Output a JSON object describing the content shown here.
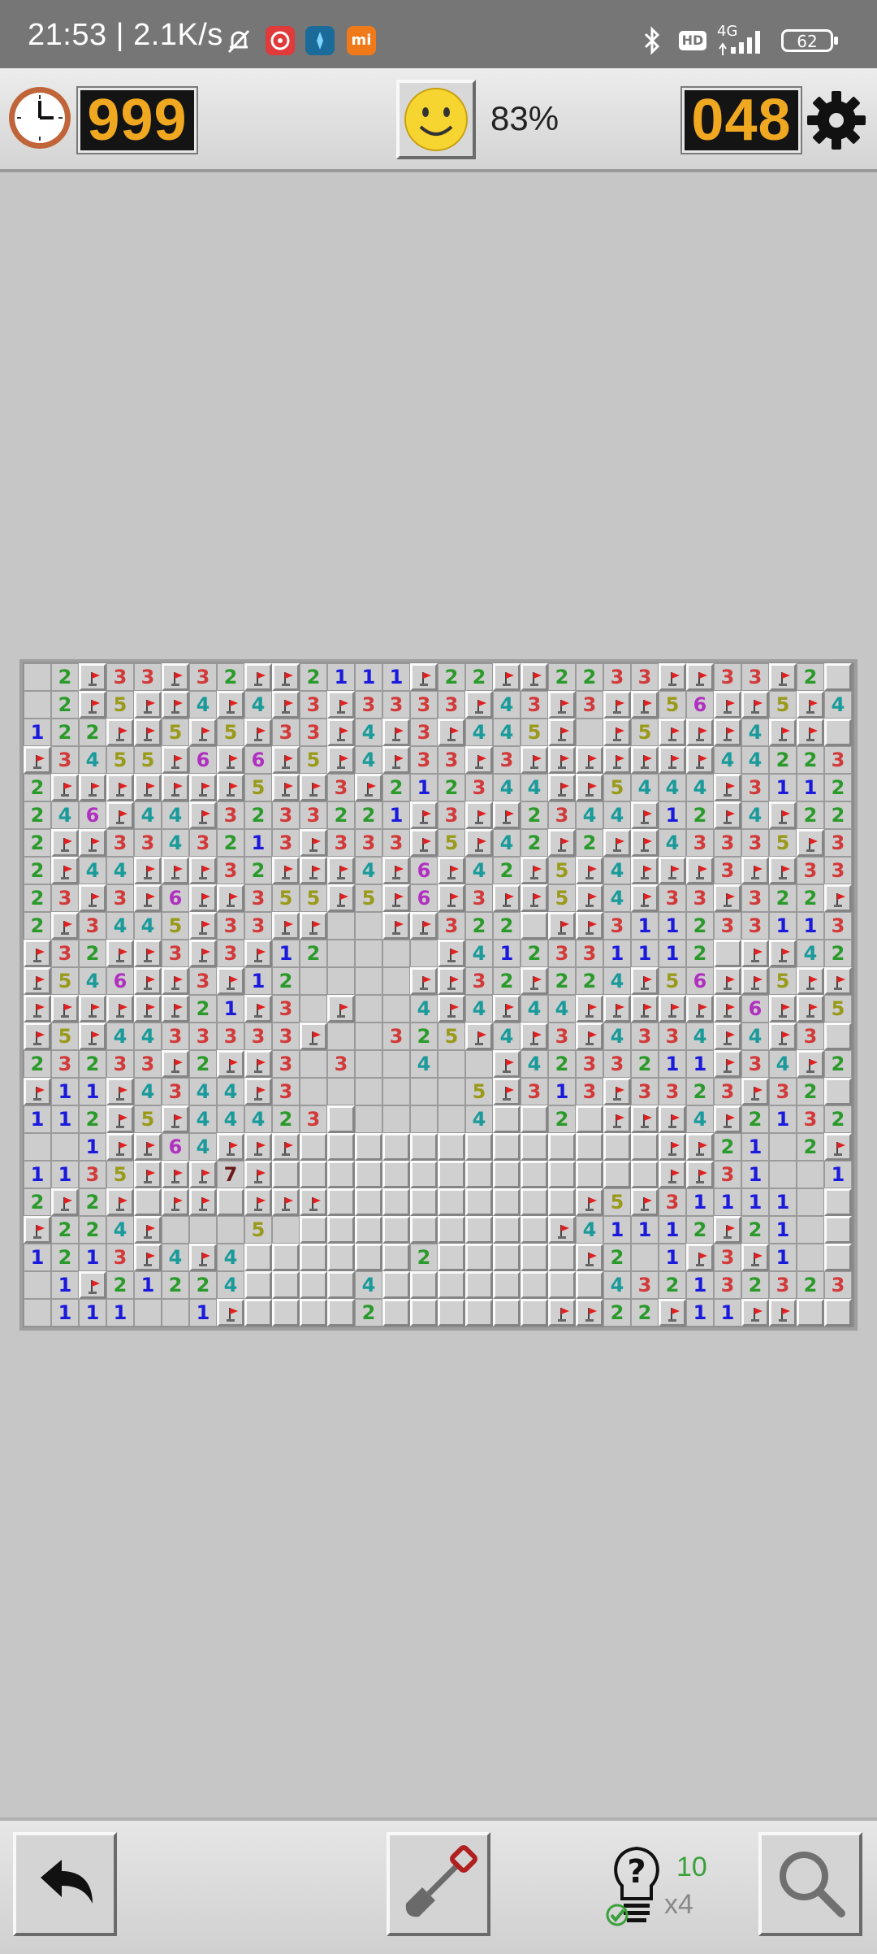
{
  "status_bar": {
    "time": "21:53 | 2.1K/s",
    "battery": "62",
    "network": "4G",
    "hd": "HD",
    "app_badge": "mi",
    "icons": [
      "mute-bell-icon",
      "netease-music-icon",
      "compass-app-icon",
      "mi-app-icon",
      "bluetooth-icon",
      "hd-icon",
      "signal-icon",
      "battery-icon"
    ]
  },
  "toolbar": {
    "timer": "999",
    "progress": "83%",
    "mines_left": "048",
    "icons": [
      "clock-icon",
      "smiley-face-icon",
      "settings-gear-icon"
    ]
  },
  "board": {
    "cols": 30,
    "rows": 24,
    "legend": "F = flag, . = open empty, 0 = unopened, digits = revealed numbers",
    "grid": [
      ".2F33F32FF2111F22FF2233FF33F2",
      ".2F5FF4F4F3F3333F43F3FF56FF5F4",
      "122FF5F5F33F4F3F445F.F5FFF4FF",
      "F3455F6F6F5F4F33F3FFFFFFF442233",
      "2FFFFFFF5FF3F212344FF5444F3112F",
      "246F44F3233221F3FF2344F12F4F22F",
      "2FF3343213F333F5F42F2FF43335F322",
      "2F44FFF32FFF4F6F42F5F4FFF3FF33F",
      "23F3F6FF355F5F6F3FF5F4F33F322FF",
      "2F3445F33FF..FF3220FF3112331133",
      "F32FF3F3F12....F4123311120FF4233F",
      "F546FF3F12....FF32F224F56FF5FF",
      "FFFFFF21F3.F..4F4F44FFFFFF6FF5F",
      "F5F4433333F..325F4F3F4334F4F3",
      "23233F2FF3.3..4..F4233211F34F2",
      "F11F4344F3......5F313F3323F32",
      "112F5F444230....40020FFF4F2132",
      "..1FF64FFF0000000000000FF21.2F",
      "1135FFF7F00000000000000FF31..11",
      "2F2F0FF0FFF000000000F5F31111.",
      "F224F...5.000000000F41112F21.",
      "1213F4F4000000200000F2.1F3F1.",
      ".1F2122400004000000004321323232",
      ".111..1F00002000000FF22F11FF"
    ]
  },
  "bottom_bar": {
    "hint_count": "10",
    "hint_multiplier": "x4",
    "icons": [
      "undo-arrow-icon",
      "shovel-icon",
      "hint-bulb-icon",
      "magnifier-icon"
    ]
  },
  "colors": {
    "n1": "#1a1adc",
    "n2": "#2a9a2a",
    "n3": "#d23a3a",
    "n4": "#1a9a9a",
    "n5": "#9a9a1a",
    "n6": "#b030c0",
    "n7": "#6a1a1a",
    "lcd_digits": "#f0a820",
    "flag_red": "#e02020"
  }
}
